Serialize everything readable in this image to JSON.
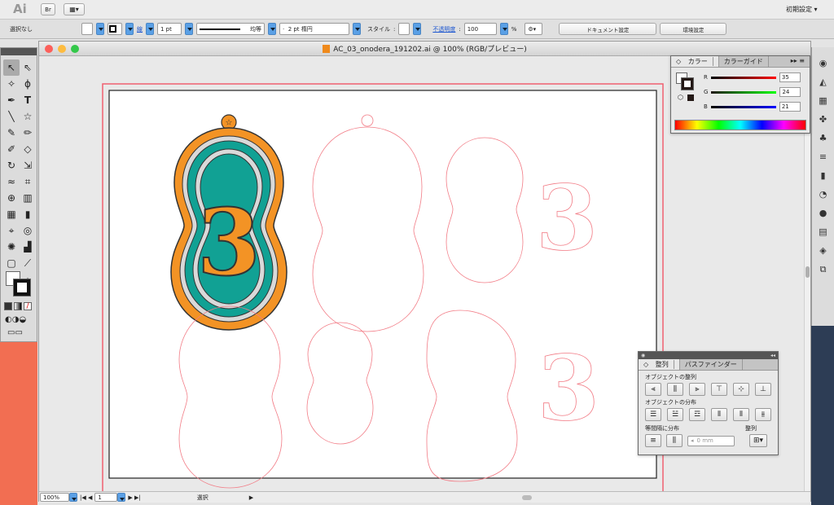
{
  "app": {
    "logo": "Ai",
    "bridge_label": "Br",
    "workspace": "初期設定"
  },
  "control": {
    "selection": "選択なし",
    "stroke_label": "線",
    "stroke_width": "1 pt",
    "stroke_style": "均等",
    "brush": "2 pt 楕円",
    "style_label": "スタイル",
    "opacity_label": "不透明度",
    "opacity": "100",
    "percent": "%",
    "doc_setup": "ドキュメント設定",
    "prefs": "環境設定"
  },
  "window": {
    "title": "AC_03_onodera_191202.ai @ 100% (RGB/プレビュー)"
  },
  "status": {
    "zoom": "100%",
    "page": "1",
    "tool": "選択"
  },
  "color": {
    "tab1": "カラー",
    "tab2": "カラーガイド",
    "r_label": "R",
    "g_label": "G",
    "b_label": "B",
    "r": "35",
    "g": "24",
    "b": "21"
  },
  "align": {
    "tab1": "整列",
    "tab2": "パスファインダー",
    "objects_align": "オブジェクトの整列",
    "objects_dist": "オブジェクトの分布",
    "spacing": "等間隔に分布",
    "align_to": "整列",
    "mm": "0 mm"
  },
  "colors": {
    "orange": "#f39325",
    "teal": "#11a194",
    "gray": "#d9d9d9",
    "outline_red": "#f27c86",
    "artboard_red": "#f06070"
  },
  "icons": [
    "selection-icon",
    "direct-selection-icon",
    "magic-wand-icon",
    "lasso-icon",
    "pen-icon",
    "type-icon",
    "line-icon",
    "star-icon",
    "brush-icon",
    "pencil-icon",
    "blob-brush-icon",
    "eraser-icon",
    "rotate-icon",
    "scale-icon",
    "warp-icon",
    "free-transform-icon",
    "shape-builder-icon",
    "perspective-icon",
    "mesh-icon",
    "gradient-icon",
    "eyedropper-icon",
    "blend-icon",
    "symbol-sprayer-icon",
    "column-graph-icon",
    "artboard-icon",
    "slice-icon",
    "hand-icon",
    "zoom-icon"
  ]
}
